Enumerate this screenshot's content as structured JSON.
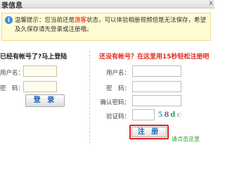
{
  "dialog": {
    "title": "录信息",
    "close_glyph": "x"
  },
  "notice": {
    "icon": "info-icon",
    "text_before": "温馨提示：您当前还是",
    "guest_word": "游客",
    "text_after": "状态，可以体验相册视频但是无法保存，希望及久保存请先登录或注册哦。"
  },
  "login": {
    "heading": "已经有帐号了?马上登陆",
    "username_label": "用户名：",
    "password_label": "密　码：",
    "username_value": "",
    "password_value": "",
    "submit_label": "登 录"
  },
  "register": {
    "heading": "还没有帐号？在这里用15秒轻松注册吧",
    "username_label": "用户名：",
    "password_label": "密　码：",
    "confirm_label": "确认密码：",
    "captcha_label": "验证码：",
    "username_value": "",
    "password_value": "",
    "confirm_value": "",
    "captcha_value": "",
    "captcha_chars": [
      "5",
      "8",
      "d",
      "c"
    ],
    "captcha_colors": [
      "#3fa9d8",
      "#6f6f6f",
      "#2f9a5a",
      "#b0b0b0"
    ],
    "submit_label": "注 册",
    "hint": "请点击这里"
  }
}
